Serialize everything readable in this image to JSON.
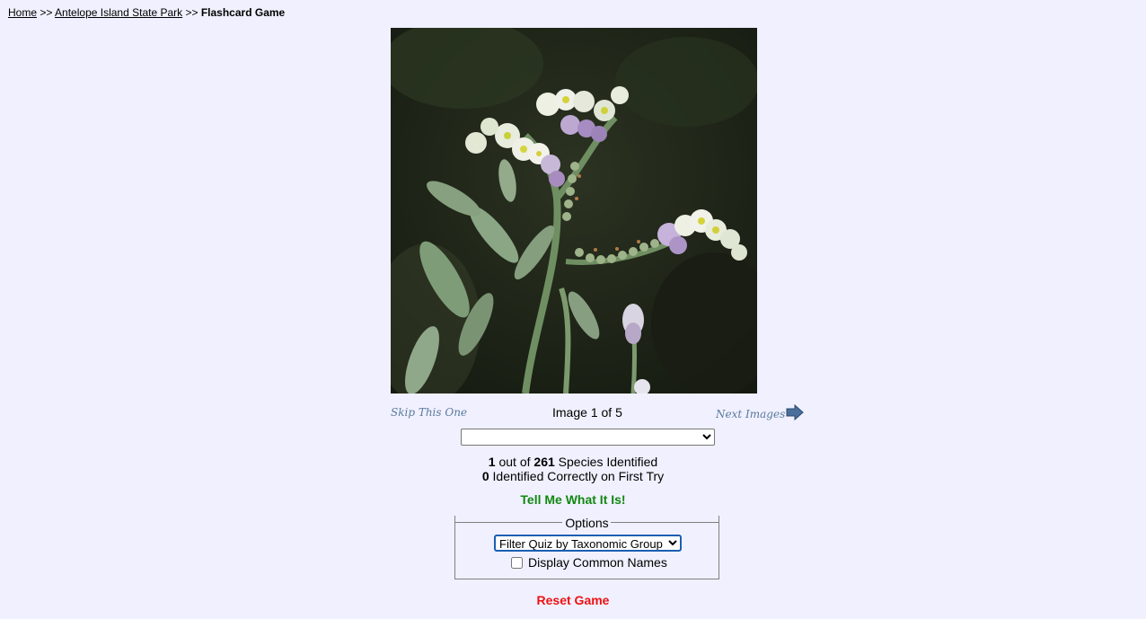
{
  "breadcrumb": {
    "home": "Home",
    "separator": ">>",
    "park": "Antelope Island State Park",
    "current": "Flashcard Game"
  },
  "nav": {
    "skip_label": "Skip This One",
    "counter_prefix": "Image",
    "counter_current": "1",
    "counter_of": "of",
    "counter_total": "5",
    "next_label": "Next Images"
  },
  "species_select": {
    "selected": ""
  },
  "stats": {
    "identified_count": "1",
    "out_of": "out of",
    "total_species": "261",
    "species_identified_label": "Species Identified",
    "first_try_count": "0",
    "first_try_label": "Identified Correctly on First Try"
  },
  "tell_me": "Tell Me What It Is!",
  "options": {
    "legend": "Options",
    "filter_selected": "Filter Quiz by Taxonomic Group",
    "common_names_label": "Display Common Names",
    "common_names_checked": false
  },
  "reset": "Reset Game",
  "colors": {
    "background": "#f0f0fe",
    "tell_me": "#118811",
    "reset": "#ee1111",
    "nav_link": "#5a7a9c",
    "arrow": "#4a6f9b"
  },
  "icons": {
    "next": "right-arrow-icon"
  }
}
